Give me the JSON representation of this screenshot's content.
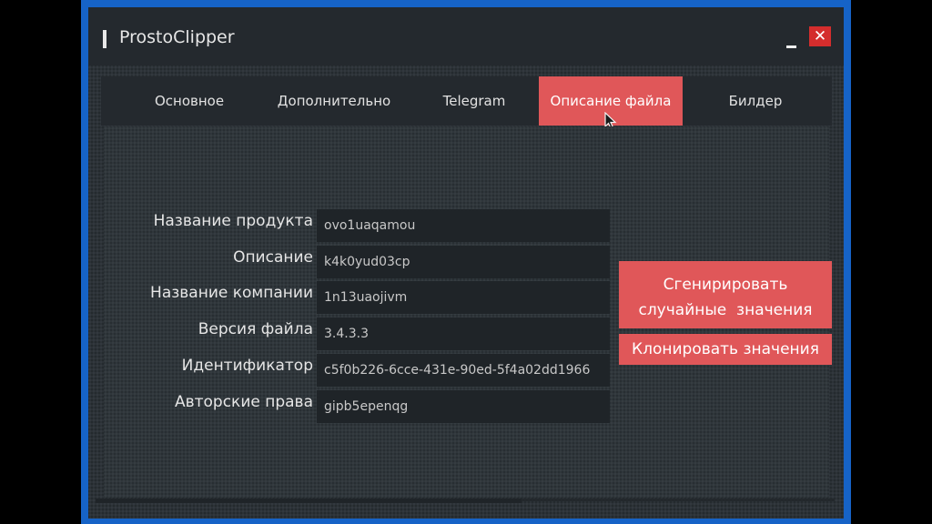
{
  "window": {
    "title": "ProstoClipper",
    "close_label": "✕"
  },
  "tabs": [
    {
      "label": "Основное",
      "active": false
    },
    {
      "label": "Дополнительно",
      "active": false
    },
    {
      "label": "Telegram",
      "active": false
    },
    {
      "label": "Описание файла",
      "active": true
    },
    {
      "label": "Билдер",
      "active": false
    }
  ],
  "fields": [
    {
      "label": "Название продукта",
      "value": "ovo1uaqamou"
    },
    {
      "label": "Описание",
      "value": "k4k0yud03cp"
    },
    {
      "label": "Название компании",
      "value": "1n13uaojivm"
    },
    {
      "label": "Версия файла",
      "value": "3.4.3.3"
    },
    {
      "label": "Идентификатор",
      "value": "c5f0b226-6cce-431e-90ed-5f4a02dd1966"
    },
    {
      "label": "Авторские права",
      "value": "gipb5epenqg"
    }
  ],
  "buttons": {
    "generate_line1": "Сгенирировать",
    "generate_line2": "случайные  значения",
    "clone": "Клонировать значения"
  },
  "colors": {
    "accent": "#e05759",
    "frame": "#1663c7",
    "close": "#d42d2d",
    "background": "#2c3237"
  },
  "icons": {
    "cursor": "mouse-cursor-icon",
    "close": "close-icon",
    "minimize": "minimize-icon"
  }
}
